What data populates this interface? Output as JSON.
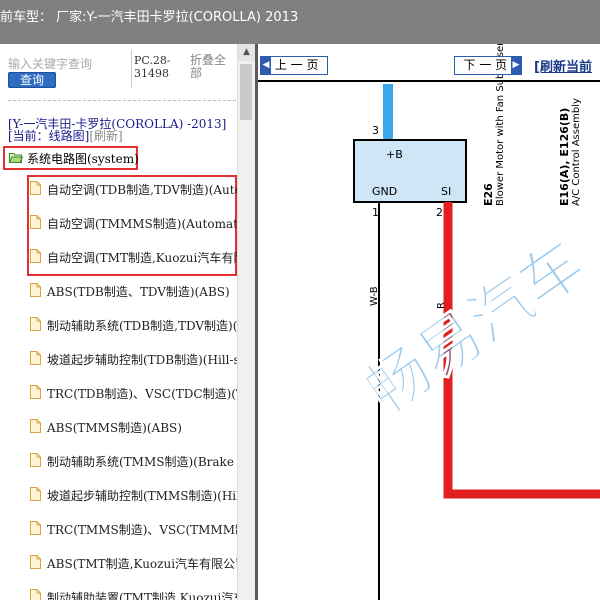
{
  "title": "前车型： 厂家:Y-一汽丰田卡罗拉(COROLLA) 2013",
  "search": {
    "placeholder": "输入关键字查询",
    "button": "查询"
  },
  "pc_label": "PC.28-31498",
  "collapse_label": "折叠全部",
  "vehicle": "[Y-一汽丰田-卡罗拉(COROLLA) -2013]",
  "current": {
    "prefix": "[当前：线路图]",
    "refresh": "[刷新]"
  },
  "tree": {
    "root": "系统电路图(system)",
    "items": [
      "自动空调(TDB制造,TDV制造)(Automatic Air Conditioning)",
      "自动空调(TMMMS制造)(Automatic Air Conditioning)",
      "自动空调(TMT制造,Kuozui汽车有限公司制造)",
      "ABS(TDB制造、TDV制造)(ABS)",
      "制动辅助系统(TDB制造,TDV制造)(Brake Assist)",
      "坡道起步辅助控制(TDB制造)(Hill-start Assist)",
      "TRC(TDB制造)、VSC(TDC制造)(TRC/VSC)",
      "ABS(TMMS制造)(ABS)",
      "制动辅助系统(TMMS制造)(Brake Assist)",
      "坡道起步辅助控制(TMMS制造)(Hill-start)",
      "TRC(TMMS制造)、VSC(TMMM制造)",
      "ABS(TMT制造,Kuozui汽车有限公司制造)",
      "制动辅助装置(TMT制造,Kuozui汽车有限公司)"
    ]
  },
  "nav": {
    "prev": "上 一 页",
    "next": "下 一 页",
    "refresh": "[刷新当前"
  },
  "diagram": {
    "pin3": "3",
    "pin1": "1",
    "pin2": "2",
    "box_b": "+B",
    "box_gnd": "GND",
    "box_si": "SI",
    "wire_wb": "W-B",
    "wire_r": "R",
    "e26": "E26",
    "e26_name": "Blower Motor with Fan Sub-Assembly",
    "e16": "E16(A), E126(B)",
    "e16_name": "A/C Control Assembly",
    "watermark": "畅易汽车",
    "colors": {
      "wire_blue": "#3aa8e8",
      "wire_red": "#e02020",
      "watermark": "#1e8ad6"
    }
  }
}
